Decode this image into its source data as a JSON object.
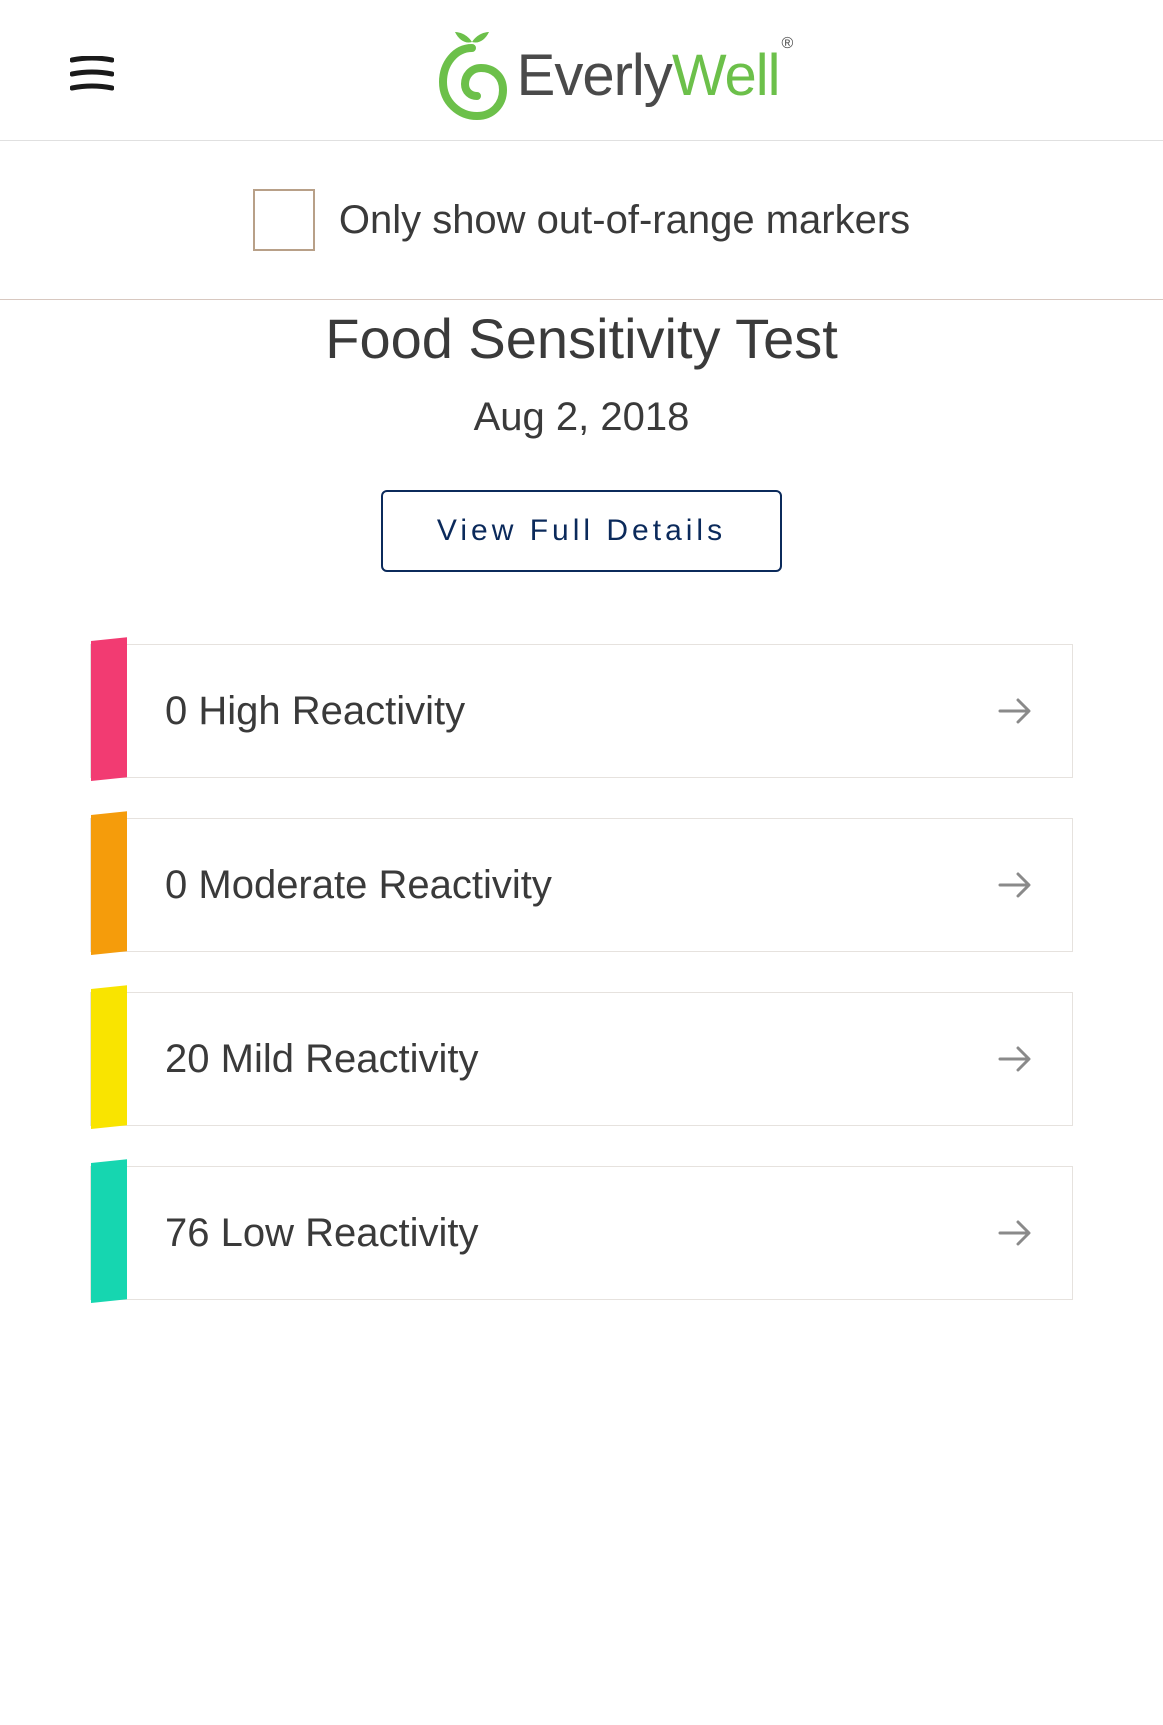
{
  "brand": {
    "name_part1": "Everly",
    "name_part2": "Well"
  },
  "filter": {
    "label": "Only show out-of-range markers",
    "checked": false
  },
  "test": {
    "title": "Food Sensitivity Test",
    "date": "Aug 2, 2018",
    "details_button": "View Full Details"
  },
  "reactivity": [
    {
      "count": 0,
      "label": "High Reactivity",
      "color": "#f23b72",
      "key": "high"
    },
    {
      "count": 0,
      "label": "Moderate Reactivity",
      "color": "#f59c0b",
      "key": "moderate"
    },
    {
      "count": 20,
      "label": "Mild Reactivity",
      "color": "#f9e400",
      "key": "mild"
    },
    {
      "count": 76,
      "label": "Low Reactivity",
      "color": "#16d6b0",
      "key": "low"
    }
  ]
}
